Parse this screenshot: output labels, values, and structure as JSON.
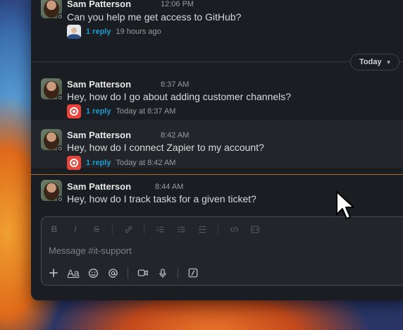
{
  "channel": {
    "composer_placeholder": "Message #it-support"
  },
  "date_divider": {
    "label": "Today"
  },
  "messages": [
    {
      "author": "Sam Patterson",
      "time": "12:06 PM",
      "text": "Can you help me get access to GitHub?",
      "thread": {
        "replies": "1 reply",
        "last_reply": "19 hours ago",
        "replier": "person"
      }
    },
    {
      "author": "Sam Patterson",
      "time": "8:37 AM",
      "text": "Hey, how do I go about adding customer channels?",
      "thread": {
        "replies": "1 reply",
        "last_reply": "Today at 8:37 AM",
        "replier": "bot"
      }
    },
    {
      "author": "Sam Patterson",
      "time": "8:42 AM",
      "text": "Hey, how do I connect Zapier to my account?",
      "thread": {
        "replies": "1 reply",
        "last_reply": "Today at 8:42 AM",
        "replier": "bot"
      }
    },
    {
      "author": "Sam Patterson",
      "time": "8:44 AM",
      "text": "Hey, how do I track tasks for a given ticket?"
    }
  ],
  "formatting_toolbar": {
    "bold": "B",
    "italic": "I",
    "strike": "S"
  },
  "action_toolbar": {
    "format_toggle": "Aa"
  },
  "colors": {
    "window_bg": "#1a1d21",
    "link_blue": "#1d9bd1",
    "new_messages_line": "#b5662b",
    "bot_red": "#e8443a"
  }
}
